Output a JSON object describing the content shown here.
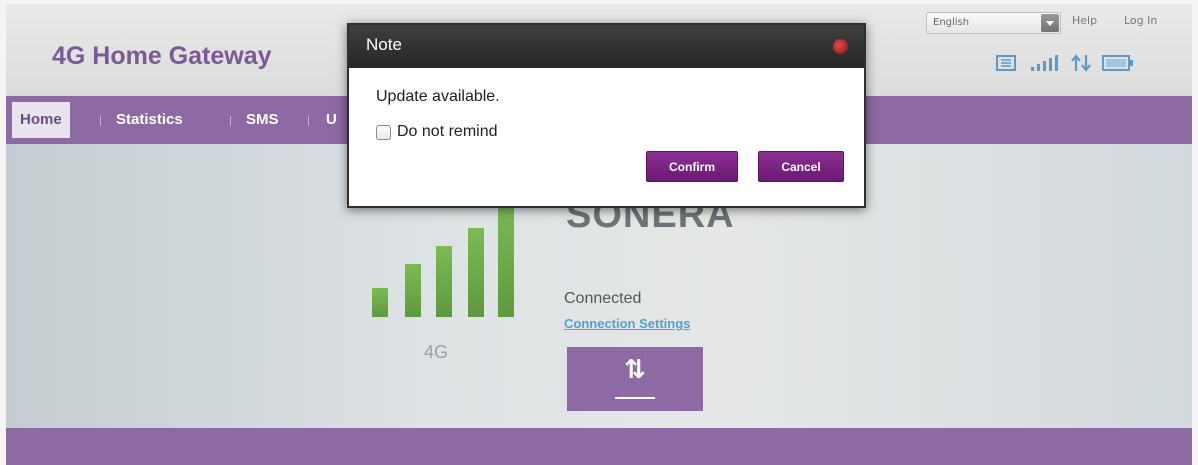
{
  "header": {
    "title": "4G Home Gateway",
    "language": "English",
    "help_label": "Help",
    "login_label": "Log In"
  },
  "nav": {
    "items": [
      {
        "label": "Home",
        "active": true
      },
      {
        "label": "Statistics"
      },
      {
        "label": "SMS"
      },
      {
        "label": "U"
      }
    ]
  },
  "status": {
    "network_type": "4G",
    "operator": "SONERA",
    "connection_status": "Connected",
    "connection_settings_label": "Connection Settings",
    "signal_bars": 5
  },
  "dialog": {
    "title": "Note",
    "message": "Update available.",
    "checkbox_label": "Do not remind",
    "confirm_label": "Confirm",
    "cancel_label": "Cancel"
  },
  "colors": {
    "brand_purple": "#8e6aa4",
    "title_purple": "#7a5a93",
    "signal_green": "#6aa84f",
    "link_blue": "#53a2cc",
    "dialog_button": "#7d2585"
  },
  "icons": [
    "sms-icon",
    "signal-strength-icon",
    "data-transfer-icon",
    "battery-icon",
    "close-icon",
    "data-toggle-icon"
  ]
}
